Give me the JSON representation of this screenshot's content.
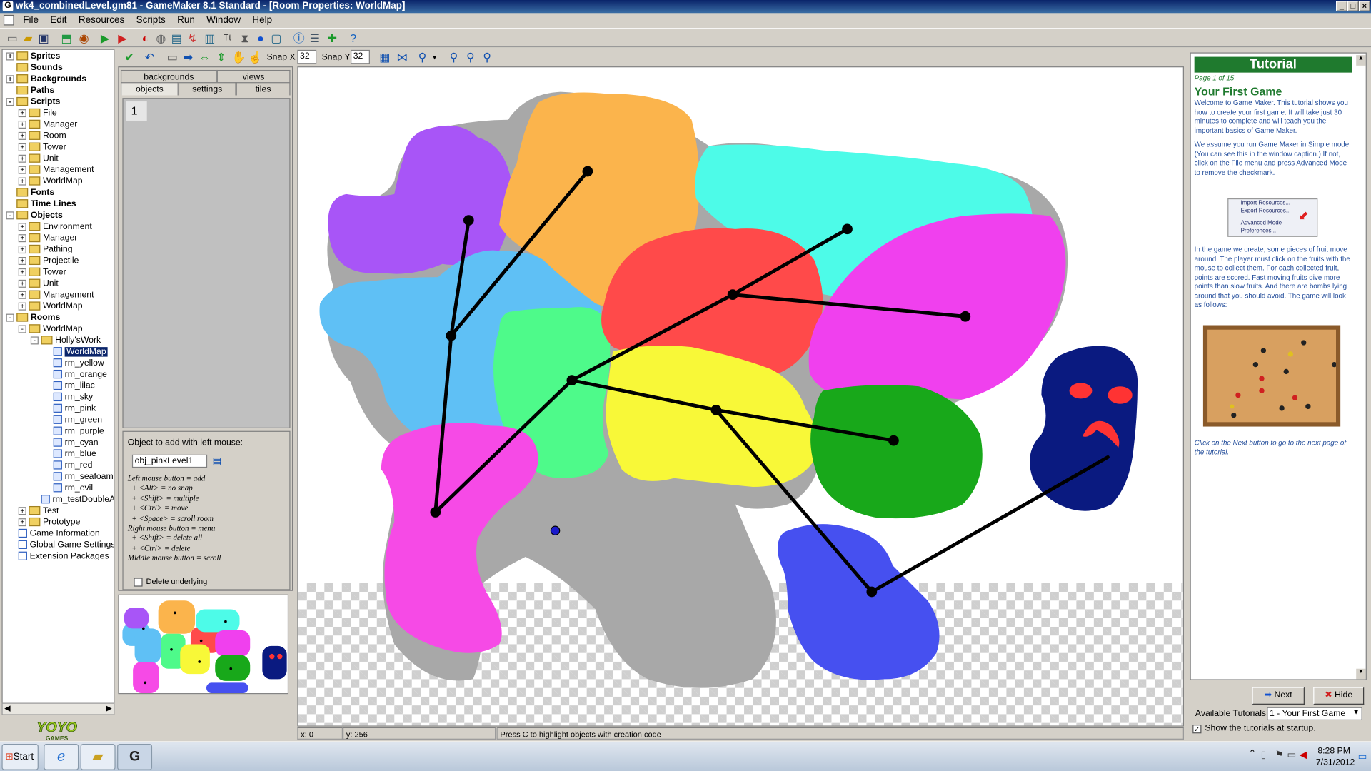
{
  "window": {
    "title": "wk4_combinedLevel.gm81 - GameMaker 8.1 Standard - [Room Properties: WorldMap]"
  },
  "menu": [
    "File",
    "Edit",
    "Resources",
    "Scripts",
    "Run",
    "Window",
    "Help"
  ],
  "tree": {
    "items": [
      {
        "label": "Sprites",
        "level": 0,
        "bold": true,
        "exp": "+"
      },
      {
        "label": "Sounds",
        "level": 0,
        "bold": true,
        "exp": ""
      },
      {
        "label": "Backgrounds",
        "level": 0,
        "bold": true,
        "exp": "+"
      },
      {
        "label": "Paths",
        "level": 0,
        "bold": true,
        "exp": ""
      },
      {
        "label": "Scripts",
        "level": 0,
        "bold": true,
        "exp": "-"
      },
      {
        "label": "File",
        "level": 1,
        "exp": "+"
      },
      {
        "label": "Manager",
        "level": 1,
        "exp": "+"
      },
      {
        "label": "Room",
        "level": 1,
        "exp": "+"
      },
      {
        "label": "Tower",
        "level": 1,
        "exp": "+"
      },
      {
        "label": "Unit",
        "level": 1,
        "exp": "+"
      },
      {
        "label": "Management",
        "level": 1,
        "exp": "+"
      },
      {
        "label": "WorldMap",
        "level": 1,
        "exp": "+"
      },
      {
        "label": "Fonts",
        "level": 0,
        "bold": true,
        "exp": ""
      },
      {
        "label": "Time Lines",
        "level": 0,
        "bold": true,
        "exp": ""
      },
      {
        "label": "Objects",
        "level": 0,
        "bold": true,
        "exp": "-"
      },
      {
        "label": "Environment",
        "level": 1,
        "exp": "+"
      },
      {
        "label": "Manager",
        "level": 1,
        "exp": "+"
      },
      {
        "label": "Pathing",
        "level": 1,
        "exp": "+"
      },
      {
        "label": "Projectile",
        "level": 1,
        "exp": "+"
      },
      {
        "label": "Tower",
        "level": 1,
        "exp": "+"
      },
      {
        "label": "Unit",
        "level": 1,
        "exp": "+"
      },
      {
        "label": "Management",
        "level": 1,
        "exp": "+"
      },
      {
        "label": "WorldMap",
        "level": 1,
        "exp": "+"
      },
      {
        "label": "Rooms",
        "level": 0,
        "bold": true,
        "exp": "-"
      },
      {
        "label": "WorldMap",
        "level": 1,
        "exp": "-"
      },
      {
        "label": "Holly'sWork",
        "level": 2,
        "exp": "-"
      },
      {
        "label": "WorldMap",
        "level": 3,
        "room": true,
        "selected": true
      },
      {
        "label": "rm_yellow",
        "level": 3,
        "room": true
      },
      {
        "label": "rm_orange",
        "level": 3,
        "room": true
      },
      {
        "label": "rm_lilac",
        "level": 3,
        "room": true
      },
      {
        "label": "rm_sky",
        "level": 3,
        "room": true
      },
      {
        "label": "rm_pink",
        "level": 3,
        "room": true
      },
      {
        "label": "rm_green",
        "level": 3,
        "room": true
      },
      {
        "label": "rm_purple",
        "level": 3,
        "room": true
      },
      {
        "label": "rm_cyan",
        "level": 3,
        "room": true
      },
      {
        "label": "rm_blue",
        "level": 3,
        "room": true
      },
      {
        "label": "rm_red",
        "level": 3,
        "room": true
      },
      {
        "label": "rm_seafoam",
        "level": 3,
        "room": true
      },
      {
        "label": "rm_evil",
        "level": 3,
        "room": true
      },
      {
        "label": "rm_testDoubleAllBas",
        "level": 2,
        "room": true
      },
      {
        "label": "Test",
        "level": 1,
        "exp": "+"
      },
      {
        "label": "Prototype",
        "level": 1,
        "exp": "+"
      },
      {
        "label": "Game Information",
        "level": 0,
        "plain": true
      },
      {
        "label": "Global Game Settings",
        "level": 0,
        "plain": true
      },
      {
        "label": "Extension Packages",
        "level": 0,
        "plain": true
      }
    ]
  },
  "room_toolbar": {
    "snap_x_label": "Snap X",
    "snap_x": "32",
    "snap_y_label": "Snap Y",
    "snap_y": "32"
  },
  "tabs": {
    "row1": [
      "backgrounds",
      "views"
    ],
    "row2": [
      "objects",
      "settings",
      "tiles"
    ]
  },
  "objects_panel": {
    "list_index": "1",
    "add_label": "Object to add with left mouse:",
    "selected_object": "obj_pinkLevel1",
    "help": [
      "Left mouse button = add",
      "  + <Alt> = no snap",
      "  + <Shift> = multiple",
      "  + <Ctrl> = move",
      "  + <Space> = scroll room",
      "Right mouse button = menu",
      "  + <Shift> = delete all",
      "  + <Ctrl> = delete",
      "Middle mouse button = scroll"
    ],
    "delete_underlying": "Delete underlying"
  },
  "status": {
    "x": "x: 0",
    "y": "y: 256",
    "hint": "Press C to highlight objects with creation code"
  },
  "tutorial": {
    "banner": "Tutorial",
    "page": "Page 1 of 15",
    "heading": "Your First Game",
    "p1": "Welcome to Game Maker. This tutorial shows you how to create your first game. It will take just 30 minutes to complete and will teach you the important basics of Game Maker.",
    "p2": "We assume you run Game Maker in Simple mode. (You can see this in the window caption.) If not, click on the File menu and press Advanced Mode to remove the checkmark.",
    "menu_items": [
      "Import Resources...",
      "Export Resources...",
      "Advanced Mode",
      "Preferences..."
    ],
    "p3": "In the game we create, some pieces of fruit move around. The player must click on the fruits with the mouse to collect them. For each collected fruit, points are scored. Fast moving fruits give more points than slow fruits. And there are bombs lying around that you should avoid. The game will look as follows:",
    "p4": "Click on the Next button to go to the next page of the tutorial.",
    "next": "Next",
    "hide": "Hide",
    "available_label": "Available Tutorials:",
    "available_value": "1 - Your First Game",
    "show_startup": "Show the tutorials at startup."
  },
  "taskbar": {
    "start": "Start",
    "time": "8:28 PM",
    "date": "7/31/2012"
  },
  "logo": {
    "text": "YOYO GAMES"
  },
  "colors": {
    "accent": "#0a246a",
    "tutorial_green": "#1f7a2e"
  }
}
